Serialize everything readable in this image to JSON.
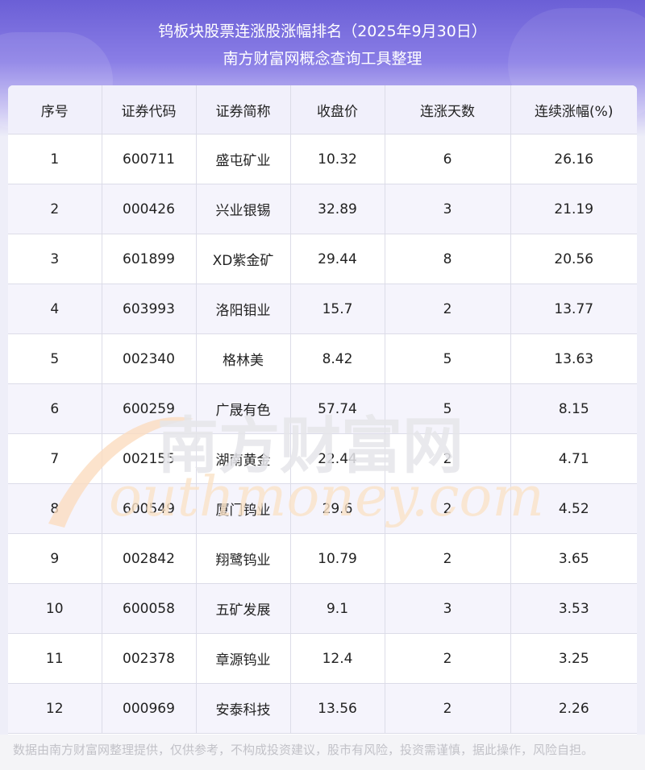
{
  "header": {
    "title_line1": "钨板块股票连涨股涨幅排名（2025年9月30日）",
    "title_line2": "南方财富网概念查询工具整理"
  },
  "table": {
    "columns": [
      "序号",
      "证券代码",
      "证券简称",
      "收盘价",
      "连涨天数",
      "连续涨幅(%)"
    ],
    "rows": [
      [
        "1",
        "600711",
        "盛屯矿业",
        "10.32",
        "6",
        "26.16"
      ],
      [
        "2",
        "000426",
        "兴业银锡",
        "32.89",
        "3",
        "21.19"
      ],
      [
        "3",
        "601899",
        "XD紫金矿",
        "29.44",
        "8",
        "20.56"
      ],
      [
        "4",
        "603993",
        "洛阳钼业",
        "15.7",
        "2",
        "13.77"
      ],
      [
        "5",
        "002340",
        "格林美",
        "8.42",
        "5",
        "13.63"
      ],
      [
        "6",
        "600259",
        "广晟有色",
        "57.74",
        "5",
        "8.15"
      ],
      [
        "7",
        "002155",
        "湖南黄金",
        "22.44",
        "2",
        "4.71"
      ],
      [
        "8",
        "600549",
        "厦门钨业",
        "29.6",
        "2",
        "4.52"
      ],
      [
        "9",
        "002842",
        "翔鹭钨业",
        "10.79",
        "2",
        "3.65"
      ],
      [
        "10",
        "600058",
        "五矿发展",
        "9.1",
        "3",
        "3.53"
      ],
      [
        "11",
        "002378",
        "章源钨业",
        "12.4",
        "2",
        "3.25"
      ],
      [
        "12",
        "000969",
        "安泰科技",
        "13.56",
        "2",
        "2.26"
      ]
    ]
  },
  "watermark": {
    "cn": "南方财富网",
    "en": "outhmoney.com",
    "colors": {
      "cn": "#e6e6ea",
      "en": "#fbe3c8",
      "swoosh": "#fbdcbf"
    }
  },
  "footer": {
    "text": "数据由南方财富网整理提供，仅供参考，不构成投资建议，股市有风险，投资需谨慎，据此操作，风险自担。"
  },
  "colors": {
    "header_gradient_top": "#6b5fd6",
    "header_row_bg": "#f1f0fb",
    "alt_row_bg": "#f5f4fc",
    "border": "#dcdce8"
  }
}
